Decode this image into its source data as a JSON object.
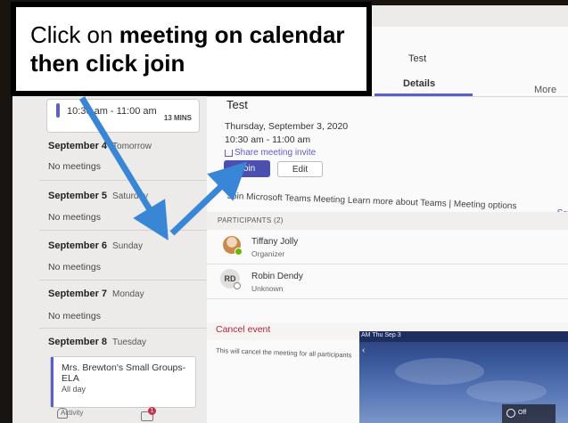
{
  "callout": {
    "part1": "Click on ",
    "bold1": "meeting on calendar then click join"
  },
  "calendar": {
    "top_event_time": "10:30 am - 11:00 am",
    "top_event_mins": "13 MINS",
    "days": [
      {
        "date": "September 4",
        "weekday": "Tomorrow",
        "status": "No meetings"
      },
      {
        "date": "September 5",
        "weekday": "Saturday",
        "status": "No meetings"
      },
      {
        "date": "September 6",
        "weekday": "Sunday",
        "status": "No meetings"
      },
      {
        "date": "September 7",
        "weekday": "Monday",
        "status": "No meetings"
      },
      {
        "date": "September 8",
        "weekday": "Tuesday"
      }
    ],
    "groups_event_title": "Mrs. Brewton's Small Groups-ELA",
    "groups_event_duration": "All day"
  },
  "bottom_nav": {
    "activity_label": "Activity",
    "chat_badge": "1"
  },
  "tabs": {
    "title": "Test",
    "details": "Details",
    "more": "More"
  },
  "meeting": {
    "title": "Test",
    "date": "Thursday, September 3, 2020",
    "time": "10:30 am - 11:00 am",
    "share": "Share meeting invite",
    "join_label": "Join",
    "edit_label": "Edit",
    "join_info": "Join Microsoft Teams Meeting  Learn more about Teams | Meeting options",
    "see_more": "See"
  },
  "participants": {
    "header": "PARTICIPANTS (2)",
    "people": [
      {
        "name": "Tiffany Jolly",
        "role": "Organizer"
      },
      {
        "name": "Robin Dendy",
        "role": "Unknown",
        "initials": "RD"
      }
    ]
  },
  "cancel": {
    "label": "Cancel event",
    "desc": "This will cancel the meeting for all participants"
  },
  "inset": {
    "status_time": "AM  Thu Sep 3",
    "tile_label": "Off"
  },
  "colors": {
    "accent": "#5b5fc7",
    "join_bg": "#4b4fb0",
    "cancel": "#b0263e",
    "arrow": "#3a86d6"
  }
}
